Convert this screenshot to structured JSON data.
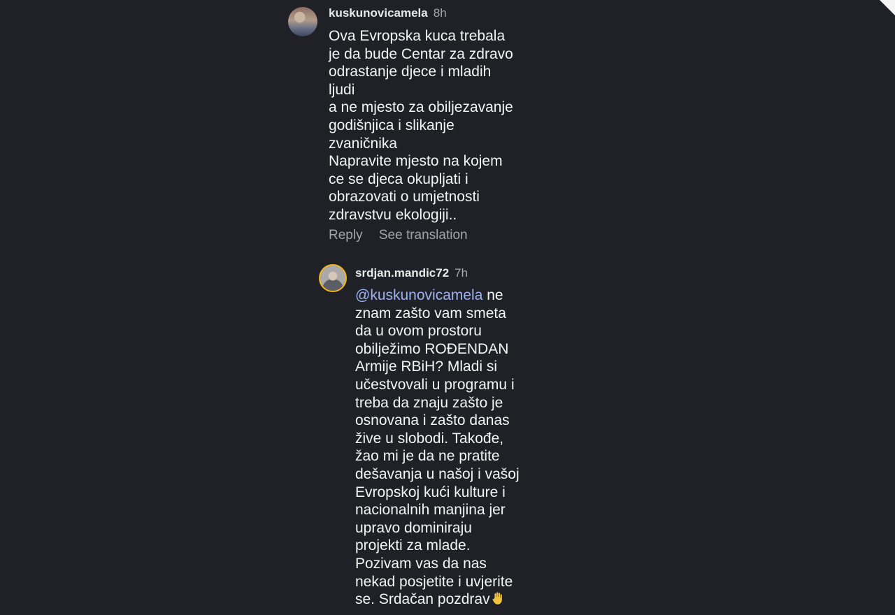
{
  "comments": [
    {
      "username": "kuskunovicamela",
      "time": "8h",
      "lines": [
        "Ova Evropska kuca trebala",
        "je da bude Centar za zdravo",
        "odrastanje djece i mladih",
        "ljudi",
        "a ne mjesto za obiljezavanje",
        "godišnjica i slikanje",
        "zvaničnika",
        "Napravite mjesto na kojem",
        "ce se djeca okupljati i",
        "obrazovati o umjetnosti",
        "zdravstvu ekologiji.."
      ],
      "actions": {
        "reply": "Reply",
        "translate": "See translation"
      }
    },
    {
      "username": "srdjan.mandic72",
      "time": "7h",
      "mention": "@kuskunovicamela",
      "first_line_rest": " ne",
      "lines": [
        "znam zašto vam smeta",
        "da u ovom prostoru",
        "obilježimo ROĐENDAN",
        "Armije RBiH? Mladi si",
        "učestvovali u programu i",
        "treba da znaju zašto je",
        "osnovana i zašto danas",
        "žive u slobodi. Takođe,",
        "žao mi je da ne pratite",
        "dešavanja u našoj i vašoj",
        "Evropskoj kući kulture i",
        "nacionalnih manjina jer",
        "upravo dominiraju",
        "projekti za mlade.",
        "Pozivam vas da nas",
        "nekad posjetite i uvjerite"
      ],
      "last_line": "se. Srdačan pozdrav"
    }
  ],
  "icons": {
    "reply_emoji": "waving-hand-icon"
  }
}
